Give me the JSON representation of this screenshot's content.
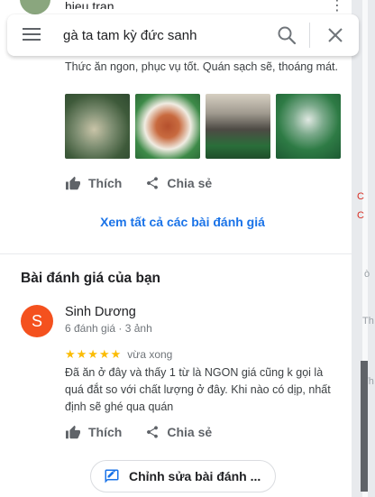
{
  "search": {
    "value": "gà ta tam kỳ đức sanh"
  },
  "previous_review": {
    "author": "hieu tran",
    "text": "Thức ăn ngon, phục vụ tốt. Quán sạch sẽ, thoáng mát.",
    "photos": [
      "photo-1",
      "photo-2",
      "photo-3",
      "photo-4"
    ],
    "like_label": "Thích",
    "share_label": "Chia sẻ"
  },
  "see_all_label": "Xem tất cả các bài đánh giá",
  "your_review": {
    "section_title": "Bài đánh giá của bạn",
    "avatar_letter": "S",
    "author": "Sinh Dương",
    "meta": "6 đánh giá · 3 ảnh",
    "stars": "★★★★★",
    "rating": 5,
    "time": "vừa xong",
    "text": "Đã ăn ở đây và thấy 1 từ là  NGON giá cũng k gọi là quá đắt so với chất lượng ở đây. Khi nào có dịp, nhất định sẽ ghé qua quán",
    "like_label": "Thích",
    "share_label": "Chia sẻ",
    "edit_label": "Chỉnh sửa bài đánh ..."
  },
  "map": {
    "letters": [
      "C",
      "C",
      "ò",
      "Th",
      "Th"
    ]
  },
  "colors": {
    "accent_blue": "#1a73e8",
    "star_yellow": "#fbbc04",
    "avatar_orange": "#f4511e",
    "icon_gray": "#5f6368"
  }
}
